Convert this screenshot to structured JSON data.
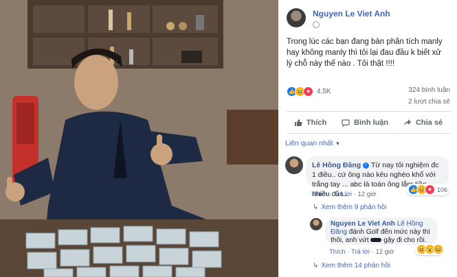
{
  "post": {
    "author": "Nguyen Le Viet Anh",
    "text": "Trong lúc các bạn đang bàn phân tích manly hay không manly thì tôi lại đau đầu k biết xử lý chỗ này thế nào . Tôi thật !!!!",
    "reaction_count": "4,5K",
    "comment_count": "324 bình luận",
    "share_count": "2 lượt chia sẻ",
    "reactions": [
      "like",
      "haha",
      "love"
    ]
  },
  "actions": {
    "like": "Thích",
    "comment": "Bình luận",
    "share": "Chia sẻ"
  },
  "sort_label": "Liên quan nhất",
  "comments": [
    {
      "author": "Lê Hồng Đăng",
      "verified": true,
      "text": "Từ nay tôi nghiệm đc 1 điều.. cứ ông nào kêu nghèo khổ với trắng tay ... abc là toàn ông lắm tiền nhiều của..",
      "like_label": "Thích",
      "reply_label": "Trả lời",
      "time": "12 giờ",
      "reaction_count": "106",
      "more_replies": "Xem thêm 9 phản hồi"
    },
    {
      "author": "Nguyen Le Viet Anh",
      "mention": "Lê Hồng Đăng",
      "text_part1": "đánh Golf đến mức này thì thôi, anh vứt",
      "text_part2": "gậy đi cho rồi.",
      "like_label": "Thích",
      "reply_label": "Trả lời",
      "time": "12 giờ",
      "more_replies": "Xem thêm 14 phản hồi"
    }
  ],
  "colors": {
    "link": "#4267b2",
    "like": "#1877f2",
    "haha": "#f7b125",
    "love": "#f33e58",
    "text": "#1d2129",
    "meta": "#606770"
  },
  "icons": [
    "globe-icon",
    "thumb-up-icon",
    "comment-icon",
    "share-icon",
    "verified-icon",
    "caret-down-icon",
    "reply-arrow-icon"
  ]
}
